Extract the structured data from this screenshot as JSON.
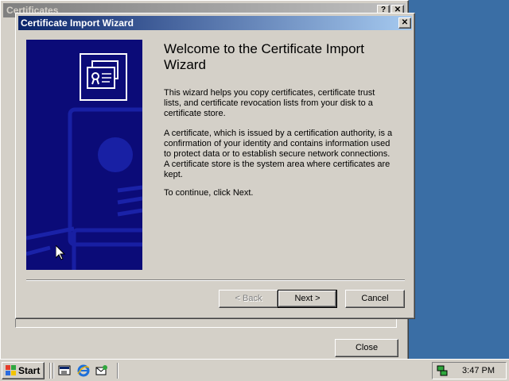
{
  "background_window": {
    "title": "Certificates",
    "help_glyph": "?",
    "close_glyph": "✕",
    "close_label": "Close"
  },
  "wizard": {
    "title": "Certificate Import Wizard",
    "close_glyph": "✕",
    "heading": "Welcome to the Certificate Import Wizard",
    "paragraphs": [
      "This wizard helps you copy certificates, certificate trust lists, and certificate revocation lists from your disk to a certificate store.",
      "A certificate, which is issued by a certification authority, is a confirmation of your identity and contains information used to protect data or to establish secure network connections. A certificate store is the system area where certificates are kept.",
      "To continue, click Next."
    ],
    "buttons": {
      "back": "< Back",
      "next": "Next >",
      "cancel": "Cancel"
    },
    "banner_icon": "certificate-icon"
  },
  "taskbar": {
    "start_label": "Start",
    "quick_launch_icons": [
      "show-desktop-icon",
      "internet-explorer-icon",
      "outlook-express-icon"
    ],
    "clock": "3:47 PM",
    "tray_icon": "network-icon"
  },
  "colors": {
    "desktop": "#3a6ea5",
    "active_title_start": "#0a246a",
    "active_title_end": "#a6caf0",
    "panel_blue": "#0b0b78",
    "face": "#d4d0c8"
  }
}
